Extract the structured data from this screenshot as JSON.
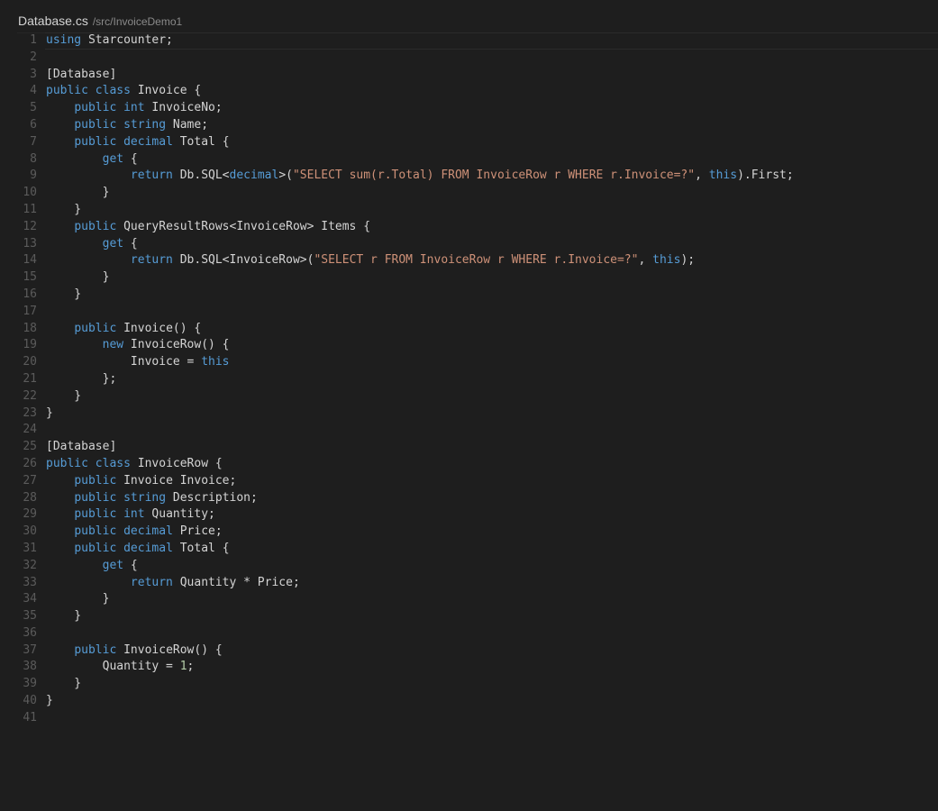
{
  "title_bar": {
    "filename": "Database.cs",
    "path": "/src/InvoiceDemo1"
  },
  "colors": {
    "background": "#1e1e1e",
    "text": "#d4d4d4",
    "keyword": "#569cd6",
    "string": "#ce9178",
    "number": "#b5cea8",
    "line_number": "#5b5b5b"
  },
  "editor": {
    "current_line": 1,
    "lines": [
      [
        [
          "using",
          "kw"
        ],
        [
          " Starcounter;",
          "plain"
        ]
      ],
      [],
      [
        [
          "[Database]",
          "plain"
        ]
      ],
      [
        [
          "public",
          "kw"
        ],
        [
          " ",
          "plain"
        ],
        [
          "class",
          "kw"
        ],
        [
          " Invoice {",
          "plain"
        ]
      ],
      [
        [
          "    ",
          "plain"
        ],
        [
          "public",
          "kw"
        ],
        [
          " ",
          "plain"
        ],
        [
          "int",
          "kw"
        ],
        [
          " InvoiceNo;",
          "plain"
        ]
      ],
      [
        [
          "    ",
          "plain"
        ],
        [
          "public",
          "kw"
        ],
        [
          " ",
          "plain"
        ],
        [
          "string",
          "kw"
        ],
        [
          " Name;",
          "plain"
        ]
      ],
      [
        [
          "    ",
          "plain"
        ],
        [
          "public",
          "kw"
        ],
        [
          " ",
          "plain"
        ],
        [
          "decimal",
          "kw"
        ],
        [
          " Total {",
          "plain"
        ]
      ],
      [
        [
          "        ",
          "plain"
        ],
        [
          "get",
          "kw"
        ],
        [
          " {",
          "plain"
        ]
      ],
      [
        [
          "            ",
          "plain"
        ],
        [
          "return",
          "ctrl"
        ],
        [
          " Db.SQL<",
          "plain"
        ],
        [
          "decimal",
          "kw"
        ],
        [
          ">(",
          "plain"
        ],
        [
          "\"SELECT sum(r.Total) FROM InvoiceRow r WHERE r.Invoice=?\"",
          "str"
        ],
        [
          ", ",
          "plain"
        ],
        [
          "this",
          "kw"
        ],
        [
          ").First;",
          "plain"
        ]
      ],
      [
        [
          "        }",
          "plain"
        ]
      ],
      [
        [
          "    }",
          "plain"
        ]
      ],
      [
        [
          "    ",
          "plain"
        ],
        [
          "public",
          "kw"
        ],
        [
          " QueryResultRows<InvoiceRow> Items {",
          "plain"
        ]
      ],
      [
        [
          "        ",
          "plain"
        ],
        [
          "get",
          "kw"
        ],
        [
          " {",
          "plain"
        ]
      ],
      [
        [
          "            ",
          "plain"
        ],
        [
          "return",
          "ctrl"
        ],
        [
          " Db.SQL<InvoiceRow>(",
          "plain"
        ],
        [
          "\"SELECT r FROM InvoiceRow r WHERE r.Invoice=?\"",
          "str"
        ],
        [
          ", ",
          "plain"
        ],
        [
          "this",
          "kw"
        ],
        [
          ");",
          "plain"
        ]
      ],
      [
        [
          "        }",
          "plain"
        ]
      ],
      [
        [
          "    }",
          "plain"
        ]
      ],
      [],
      [
        [
          "    ",
          "plain"
        ],
        [
          "public",
          "kw"
        ],
        [
          " Invoice() {",
          "plain"
        ]
      ],
      [
        [
          "        ",
          "plain"
        ],
        [
          "new",
          "kw"
        ],
        [
          " InvoiceRow() {",
          "plain"
        ]
      ],
      [
        [
          "            Invoice = ",
          "plain"
        ],
        [
          "this",
          "kw"
        ]
      ],
      [
        [
          "        };",
          "plain"
        ]
      ],
      [
        [
          "    }",
          "plain"
        ]
      ],
      [
        [
          "}",
          "plain"
        ]
      ],
      [],
      [
        [
          "[Database]",
          "plain"
        ]
      ],
      [
        [
          "public",
          "kw"
        ],
        [
          " ",
          "plain"
        ],
        [
          "class",
          "kw"
        ],
        [
          " InvoiceRow {",
          "plain"
        ]
      ],
      [
        [
          "    ",
          "plain"
        ],
        [
          "public",
          "kw"
        ],
        [
          " Invoice Invoice;",
          "plain"
        ]
      ],
      [
        [
          "    ",
          "plain"
        ],
        [
          "public",
          "kw"
        ],
        [
          " ",
          "plain"
        ],
        [
          "string",
          "kw"
        ],
        [
          " Description;",
          "plain"
        ]
      ],
      [
        [
          "    ",
          "plain"
        ],
        [
          "public",
          "kw"
        ],
        [
          " ",
          "plain"
        ],
        [
          "int",
          "kw"
        ],
        [
          " Quantity;",
          "plain"
        ]
      ],
      [
        [
          "    ",
          "plain"
        ],
        [
          "public",
          "kw"
        ],
        [
          " ",
          "plain"
        ],
        [
          "decimal",
          "kw"
        ],
        [
          " Price;",
          "plain"
        ]
      ],
      [
        [
          "    ",
          "plain"
        ],
        [
          "public",
          "kw"
        ],
        [
          " ",
          "plain"
        ],
        [
          "decimal",
          "kw"
        ],
        [
          " Total {",
          "plain"
        ]
      ],
      [
        [
          "        ",
          "plain"
        ],
        [
          "get",
          "kw"
        ],
        [
          " {",
          "plain"
        ]
      ],
      [
        [
          "            ",
          "plain"
        ],
        [
          "return",
          "ctrl"
        ],
        [
          " Quantity * Price;",
          "plain"
        ]
      ],
      [
        [
          "        }",
          "plain"
        ]
      ],
      [
        [
          "    }",
          "plain"
        ]
      ],
      [],
      [
        [
          "    ",
          "plain"
        ],
        [
          "public",
          "kw"
        ],
        [
          " InvoiceRow() {",
          "plain"
        ]
      ],
      [
        [
          "        Quantity = ",
          "plain"
        ],
        [
          "1",
          "num"
        ],
        [
          ";",
          "plain"
        ]
      ],
      [
        [
          "    }",
          "plain"
        ]
      ],
      [
        [
          "}",
          "plain"
        ]
      ],
      []
    ]
  }
}
